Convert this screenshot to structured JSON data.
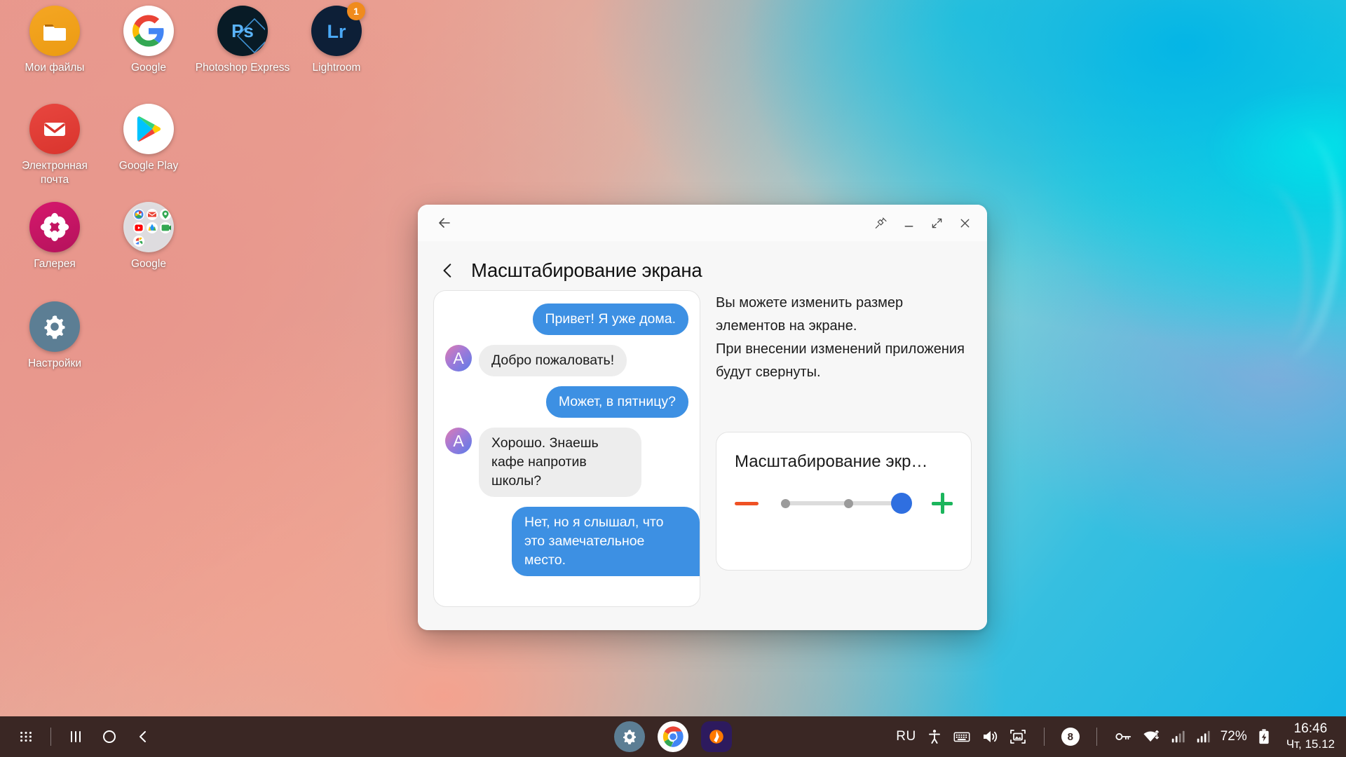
{
  "desktop": {
    "icons": [
      {
        "name": "Мои файлы",
        "icon": "my-files-icon"
      },
      {
        "name": "Google",
        "icon": "google-icon"
      },
      {
        "name": "Photoshop Express",
        "icon": "photoshop-express-icon"
      },
      {
        "name": "Lightroom",
        "icon": "lightroom-icon",
        "badge": "1"
      },
      {
        "name": "Электронная почта",
        "icon": "email-icon"
      },
      {
        "name": "Google Play",
        "icon": "google-play-icon"
      },
      {
        "name": "Галерея",
        "icon": "gallery-icon"
      },
      {
        "name": "Google",
        "icon": "google-folder-icon"
      },
      {
        "name": "Настройки",
        "icon": "settings-icon"
      }
    ]
  },
  "window": {
    "titlebar": {
      "back_icon": "arrow-left-icon",
      "pin_icon": "pin-icon",
      "minimize_icon": "minimize-icon",
      "maximize_icon": "maximize-icon",
      "close_icon": "close-icon"
    },
    "back_chevron_icon": "chevron-left-icon",
    "title": "Масштабирование экрана",
    "description": "Вы можете изменить размер элементов на экране.\nПри внесении изменений приложения будут свернуты.",
    "chat_preview": {
      "messages": [
        {
          "side": "out",
          "text": "Привет! Я уже дома.",
          "avatar": ""
        },
        {
          "side": "in",
          "text": "Добро пожаловать!",
          "avatar": "A"
        },
        {
          "side": "out",
          "text": "Может, в пятницу?",
          "avatar": ""
        },
        {
          "side": "in",
          "text": "Хорошо. Знаешь кафе напротив школы?",
          "avatar": "A"
        },
        {
          "side": "out",
          "text": "Нет, но я слышал, что это замечательное место.",
          "avatar": ""
        }
      ]
    },
    "scale_card": {
      "title": "Масштабирование экр…",
      "decrease_label": "−",
      "increase_label": "+",
      "slider": {
        "steps": 4,
        "value": 4,
        "min": 1,
        "max": 4
      },
      "minus_color": "#ef5124",
      "plus_color": "#1bb55c",
      "thumb_color": "#2f6fe0"
    }
  },
  "taskbar": {
    "apps_grid_icon": "apps-grid-icon",
    "recents_icon": "recents-icon",
    "home_icon": "home-icon",
    "back_icon": "back-icon",
    "pinned": [
      {
        "icon": "settings-app-icon"
      },
      {
        "icon": "chrome-icon"
      },
      {
        "icon": "avast-icon"
      }
    ],
    "system": {
      "language": "RU",
      "accessibility_icon": "accessibility-icon",
      "keyboard_icon": "keyboard-icon",
      "volume_icon": "volume-icon",
      "screenshot_icon": "screen-capture-icon",
      "notification_count": "8",
      "vpn_icon": "vpn-key-icon",
      "wifi_icon": "wifi-icon",
      "signal1_icon": "signal-bars-icon",
      "signal2_icon": "signal-bars-icon",
      "battery_percent": "72%",
      "battery_icon": "battery-charging-icon",
      "time": "16:46",
      "date": "Чт, 15.12"
    }
  }
}
